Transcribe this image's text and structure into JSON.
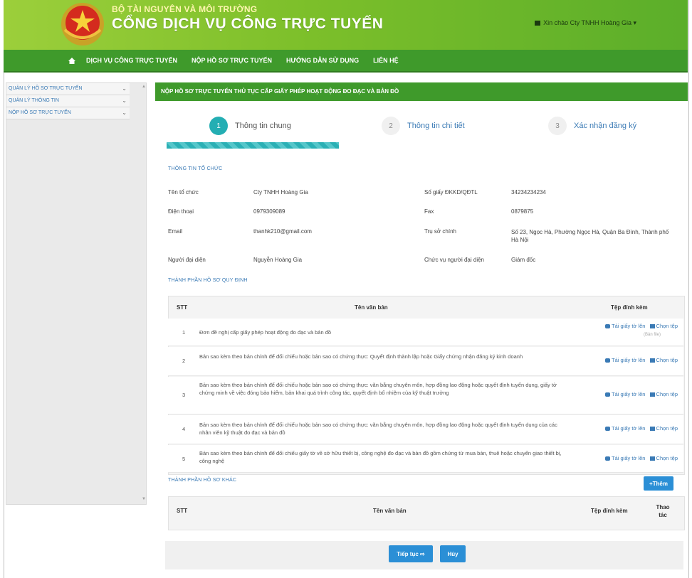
{
  "header": {
    "ministry": "BỘ TÀI NGUYÊN VÀ MÔI TRƯỜNG",
    "portal": "CỔNG DỊCH VỤ CÔNG TRỰC TUYẾN",
    "user_greeting": "Xin chào Cty TNHH Hoàng Gia ▾"
  },
  "nav": {
    "items": [
      "DỊCH VỤ CÔNG TRỰC TUYẾN",
      "NỘP HỒ SƠ TRỰC TUYẾN",
      "HƯỚNG DẪN SỬ DỤNG",
      "LIÊN HỆ"
    ]
  },
  "sidebar": {
    "items": [
      "QUẢN LÝ HỒ SƠ TRỰC TUYẾN",
      "QUẢN LÝ THÔNG TIN",
      "NỘP HỒ SƠ TRỰC TUYẾN"
    ]
  },
  "main": {
    "title": "NỘP HỒ SƠ TRỰC TUYẾN THỦ TỤC CẤP GIẤY PHÉP HOẠT ĐỘNG ĐO ĐẠC VÀ BẢN ĐỒ",
    "steps": [
      {
        "num": "1",
        "label": "Thông tin chung"
      },
      {
        "num": "2",
        "label": "Thông tin chi tiết"
      },
      {
        "num": "3",
        "label": "Xác nhận đăng ký"
      }
    ],
    "org_section": "THÔNG TIN TỔ CHỨC",
    "org": {
      "name_label": "Tên tổ chức",
      "name": "Cty TNHH Hoàng Gia",
      "phone_label": "Điện thoại",
      "phone": "0979309089",
      "email_label": "Email",
      "email": "thanhk210@gmail.com",
      "rep_label": "Người đại diện",
      "rep": "Nguyễn Hoàng Gia",
      "reg_label": "Số giấy ĐKKD/QĐTL",
      "reg": "34234234234",
      "fax_label": "Fax",
      "fax": "0879875",
      "hq_label": "Trụ sở chính",
      "hq": "Số 23, Ngọc Hà, Phường Ngọc Hà, Quận Ba Đình, Thành phố Hà Nội",
      "pos_label": "Chức vụ người đại diện",
      "pos": "Giám đốc"
    },
    "required_section": "THÀNH PHẦN HỒ SƠ QUY ĐỊNH",
    "table_headers": {
      "stt": "STT",
      "name": "Tên văn bản",
      "attach": "Tệp đính kèm"
    },
    "attach_upload": "Tải giấy tờ lên",
    "attach_choose": "Chọn tệp",
    "attach_note": "(Bản file)",
    "required_rows": [
      {
        "stt": "1",
        "name": "Đơn đề nghị cấp giấy phép hoạt động đo đạc và bản đồ"
      },
      {
        "stt": "2",
        "name": "Bản sao kèm theo bản chính để đối chiếu hoặc bản sao có chứng thực: Quyết định thành lập hoặc Giấy chứng nhận đăng ký kinh doanh"
      },
      {
        "stt": "3",
        "name": "Bản sao kèm theo bản chính để đối chiếu hoặc bản sao có chứng thực: văn bằng chuyên môn, hợp đồng lao động hoặc quyết định tuyển dụng, giấy tờ chứng minh về việc đóng bảo hiểm, bản khai quá trình công tác, quyết định bổ nhiệm của kỹ thuật trưởng"
      },
      {
        "stt": "4",
        "name": "Bản sao kèm theo bản chính để đối chiếu hoặc bản sao có chứng thực: văn bằng chuyên môn, hợp đồng lao động hoặc quyết định tuyển dụng của các nhân viên kỹ thuật đo đạc và bản đồ"
      },
      {
        "stt": "5",
        "name": "Bản sao kèm theo bản chính để đối chiếu giấy tờ về sở hữu thiết bị, công nghệ đo đạc và bản đồ gồm chứng từ mua bán, thuê hoặc chuyển giao thiết bị, công nghệ"
      }
    ],
    "other_section": "THÀNH PHẦN HỒ SƠ KHÁC",
    "add_button": "+Thêm",
    "other_headers": {
      "stt": "STT",
      "name": "Tên văn bản",
      "attach": "Tệp đính kèm",
      "action": "Thao tác"
    },
    "next_button": "Tiếp tục ⇨",
    "cancel_button": "Hủy"
  },
  "colors": {
    "header_green": "#7cbf2a",
    "nav_green": "#3f9a2b",
    "step_teal": "#24aeb3",
    "button_blue": "#2b8fd6",
    "link_blue": "#3a7ab5"
  }
}
